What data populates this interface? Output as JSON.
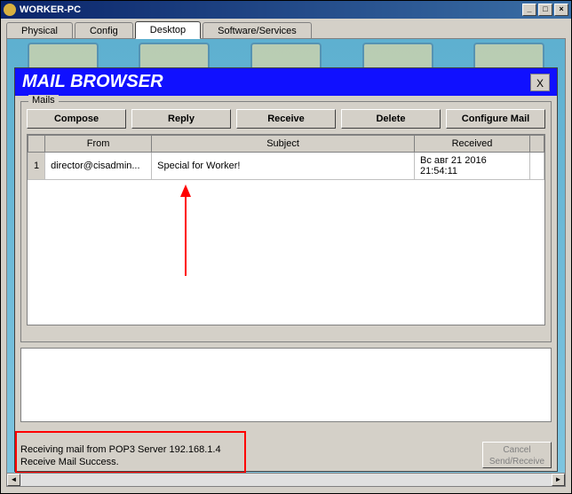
{
  "window": {
    "title": "WORKER-PC",
    "min": "_",
    "max": "□",
    "close": "×"
  },
  "tabs": {
    "physical": "Physical",
    "config": "Config",
    "desktop": "Desktop",
    "software": "Software/Services"
  },
  "mail": {
    "title": "MAIL BROWSER",
    "close_x": "X",
    "group_label": "Mails",
    "buttons": {
      "compose": "Compose",
      "reply": "Reply",
      "receive": "Receive",
      "delete": "Delete",
      "configure": "Configure Mail"
    },
    "headers": {
      "from": "From",
      "subject": "Subject",
      "received": "Received"
    },
    "rows": [
      {
        "num": "1",
        "from": "director@cisadmin...",
        "subject": "Special for Worker!",
        "received": "Вс авг 21 2016 21:54:11"
      }
    ],
    "status": {
      "line1": "Receiving mail from POP3 Server 192.168.1.4",
      "line2": "Receive Mail Success."
    },
    "cancel": {
      "line1": "Cancel",
      "line2": "Send/Receive"
    }
  },
  "scroll": {
    "left": "◄",
    "right": "►"
  }
}
